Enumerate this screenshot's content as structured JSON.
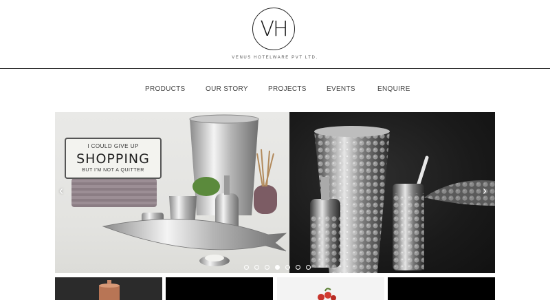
{
  "brand": {
    "logo_mark": "VH",
    "tagline": "VENUS HOTELWARE PVT LTD."
  },
  "nav": {
    "items": [
      "PRODUCTS",
      "OUR STORY",
      "PROJECTS",
      "EVENTS",
      "ENQUIRE"
    ]
  },
  "slider": {
    "prev_icon": "‹",
    "next_icon": "›",
    "dot_count": 7,
    "active_dot": 3,
    "sign": {
      "line1": "I COULD GIVE UP",
      "line2": "SHOPPING",
      "line3": "BUT I'M NOT A QUITTER"
    }
  },
  "colors": {
    "header_rule": "#2a2a2a",
    "nav_text": "#444444",
    "dark_panel": "#1a1a1a"
  }
}
